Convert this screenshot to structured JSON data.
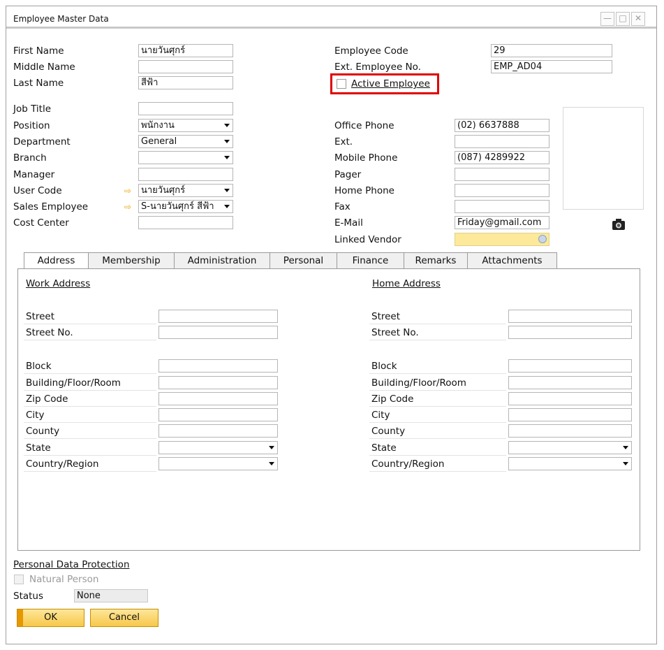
{
  "window": {
    "title": "Employee Master Data"
  },
  "left_fields": [
    {
      "label": "First Name",
      "value": "นายวันศุกร์",
      "dropdown": false,
      "link": false
    },
    {
      "label": "Middle Name",
      "value": "",
      "dropdown": false,
      "link": false
    },
    {
      "label": "Last Name",
      "value": "สีฟ้า",
      "dropdown": false,
      "link": false
    },
    {
      "label": "Job Title",
      "value": "",
      "dropdown": false,
      "link": false
    },
    {
      "label": "Position",
      "value": "พนักงาน",
      "dropdown": true,
      "link": false
    },
    {
      "label": "Department",
      "value": "General",
      "dropdown": true,
      "link": false
    },
    {
      "label": "Branch",
      "value": "",
      "dropdown": true,
      "link": false
    },
    {
      "label": "Manager",
      "value": "",
      "dropdown": false,
      "link": false
    },
    {
      "label": "User Code",
      "value": "นายวันศุกร์",
      "dropdown": true,
      "link": true
    },
    {
      "label": "Sales Employee",
      "value": "S-นายวันศุกร์ สีฟ้า",
      "dropdown": true,
      "link": true
    },
    {
      "label": "Cost Center",
      "value": "",
      "dropdown": false,
      "link": false
    }
  ],
  "right_top": {
    "employee_code_label": "Employee Code",
    "employee_code": "29",
    "ext_employee_label": "Ext. Employee No.",
    "ext_employee": "EMP_AD04",
    "active_label": "Active Employee"
  },
  "right_fields": [
    {
      "label": "Office Phone",
      "value": "(02) 6637888"
    },
    {
      "label": "Ext.",
      "value": ""
    },
    {
      "label": "Mobile Phone",
      "value": "(087) 4289922"
    },
    {
      "label": "Pager",
      "value": ""
    },
    {
      "label": "Home Phone",
      "value": ""
    },
    {
      "label": "Fax",
      "value": ""
    },
    {
      "label": "E-Mail",
      "value": "Friday@gmail.com"
    },
    {
      "label": "Linked Vendor",
      "value": ""
    }
  ],
  "tabs": [
    "Address",
    "Membership",
    "Administration",
    "Personal",
    "Finance",
    "Remarks",
    "Attachments"
  ],
  "address": {
    "work_title": "Work Address",
    "home_title": "Home Address",
    "fields": [
      "Street",
      "Street No.",
      "Block",
      "Building/Floor/Room",
      "Zip Code",
      "City",
      "County",
      "State",
      "Country/Region"
    ]
  },
  "footer": {
    "pdp_title": "Personal Data Protection",
    "natural_person": "Natural Person",
    "status_label": "Status",
    "status_value": "None",
    "ok": "OK",
    "cancel": "Cancel"
  },
  "icons": {
    "camera": "camera-icon",
    "link_arrow": "link-arrow-icon",
    "vendor_lookup": "lookup-icon"
  }
}
